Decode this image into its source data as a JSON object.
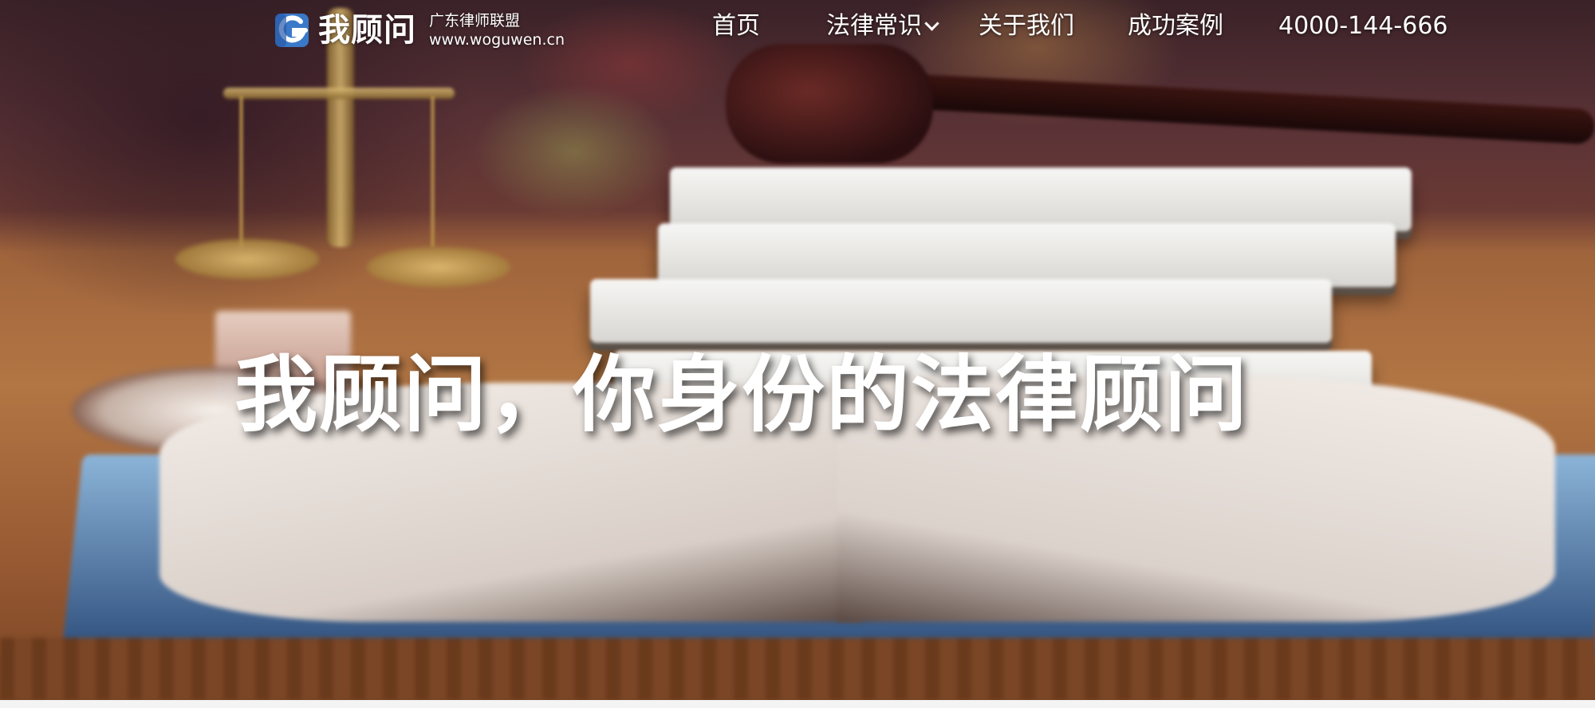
{
  "brand": {
    "name": "我顾问",
    "tagline": "广东律师联盟",
    "url": "www.woguwen.cn",
    "accent": "#3a78c8"
  },
  "nav": {
    "home": "首页",
    "legal_knowledge": "法律常识",
    "about": "关于我们",
    "cases": "成功案例",
    "phone": "4000-144-666"
  },
  "hero": {
    "title": "我顾问，你身份的法律顾问"
  }
}
